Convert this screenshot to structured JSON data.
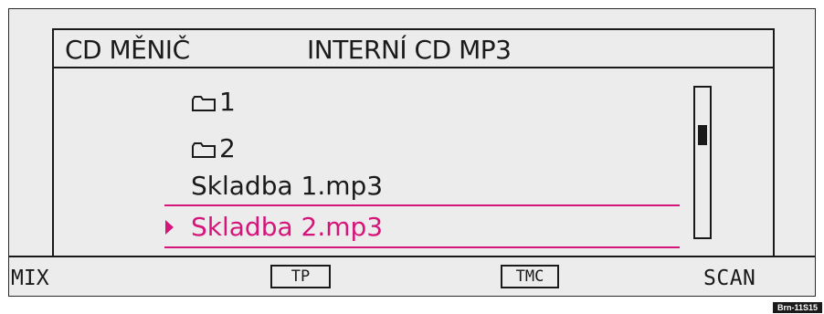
{
  "header": {
    "source_label": "CD MĚNIČ",
    "source_name": "INTERNÍ CD MP3"
  },
  "list": {
    "items": [
      {
        "type": "folder",
        "label": "1"
      },
      {
        "type": "folder",
        "label": "2"
      },
      {
        "type": "file",
        "label": "Skladba 1.mp3"
      },
      {
        "type": "file",
        "label": "Skladba 2.mp3",
        "selected": true
      }
    ]
  },
  "softkeys": {
    "mix": "MIX",
    "tp": "TP",
    "tmc": "TMC",
    "scan": "SCAN"
  },
  "figure_code": "Brn-11S15",
  "colors": {
    "screen_bg": "#ececec",
    "text": "#1a1a1a",
    "highlight": "#d6157a"
  },
  "icons": {
    "folder": "folder-icon",
    "selection": "play-arrow-icon"
  }
}
